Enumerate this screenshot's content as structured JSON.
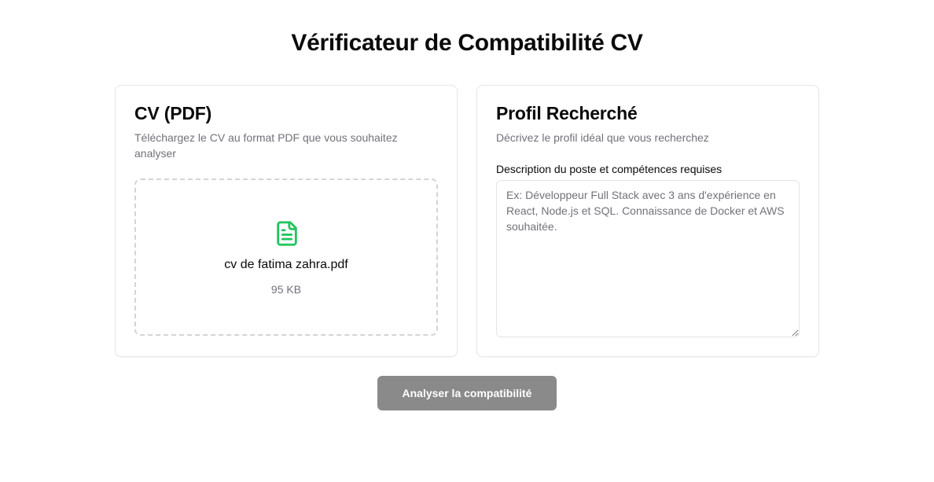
{
  "page": {
    "title": "Vérificateur de Compatibilité CV"
  },
  "cv_card": {
    "title": "CV (PDF)",
    "description": "Téléchargez le CV au format PDF que vous souhaitez analyser",
    "file": {
      "icon": "file-text-icon",
      "icon_color": "#22c55e",
      "name": "cv de fatima zahra.pdf",
      "size": "95 KB"
    }
  },
  "profile_card": {
    "title": "Profil Recherché",
    "description": "Décrivez le profil idéal que vous recherchez",
    "field_label": "Description du poste et compétences requises",
    "textarea": {
      "value": "",
      "placeholder": "Ex: Développeur Full Stack avec 3 ans d'expérience en React, Node.js et SQL. Connaissance de Docker et AWS souhaitée."
    }
  },
  "actions": {
    "analyze_label": "Analyser la compatibilité",
    "analyze_color": "#8a8a8a",
    "analyze_disabled": true
  }
}
